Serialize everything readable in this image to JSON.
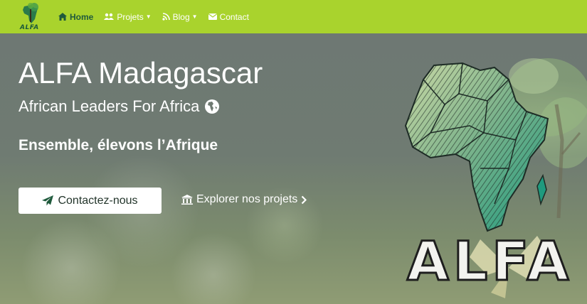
{
  "navbar": {
    "brand_text": "ALFA",
    "items": [
      {
        "label": "Home",
        "icon": "home-icon",
        "active": true
      },
      {
        "label": "Projets",
        "icon": "users-icon",
        "dropdown": true
      },
      {
        "label": "Blog",
        "icon": "blog-icon",
        "dropdown": true
      },
      {
        "label": "Contact",
        "icon": "envelope-icon"
      }
    ]
  },
  "hero": {
    "title": "ALFA Madagascar",
    "subtitle": "African Leaders For Africa",
    "subtitle_icon": "globe-africa-icon",
    "tagline": "Ensemble, élevons l’Afrique",
    "contact_button": "Contactez-nous",
    "contact_icon": "paper-plane-icon",
    "explore_link": "Explorer nos projets",
    "explore_icon": "building-icon",
    "artwork_text": "ALFA"
  },
  "colors": {
    "navbar_bg": "#a9d32d",
    "active_nav": "#1f5a3c",
    "button_bg": "#ffffff",
    "hero_text": "#ffffff"
  }
}
